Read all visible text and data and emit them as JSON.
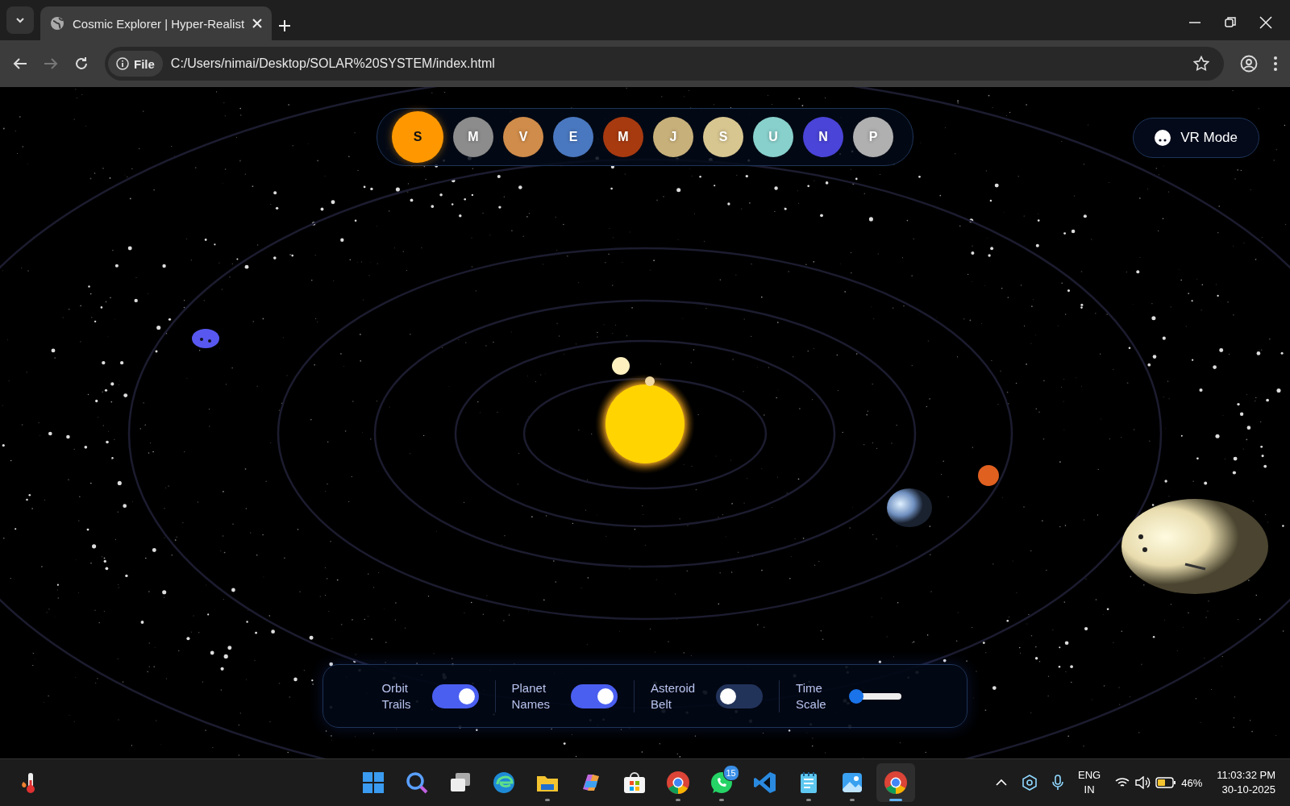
{
  "browser": {
    "tab": {
      "title": "Cosmic Explorer | Hyper-Realist",
      "selected": true
    },
    "address": {
      "scheme_chip": "File",
      "url": "C:/Users/nimai/Desktop/SOLAR%20SYSTEM/index.html"
    }
  },
  "planet_nav": [
    {
      "letter": "S",
      "color": "#ff9800",
      "selected": true
    },
    {
      "letter": "M",
      "color": "#8c8c8c",
      "selected": false
    },
    {
      "letter": "V",
      "color": "#d08c4a",
      "selected": false
    },
    {
      "letter": "E",
      "color": "#4a78c0",
      "selected": false
    },
    {
      "letter": "M",
      "color": "#a83a10",
      "selected": false
    },
    {
      "letter": "J",
      "color": "#c8b07a",
      "selected": false
    },
    {
      "letter": "S",
      "color": "#d8c690",
      "selected": false
    },
    {
      "letter": "U",
      "color": "#88d0cc",
      "selected": false
    },
    {
      "letter": "N",
      "color": "#4a44d8",
      "selected": false
    },
    {
      "letter": "P",
      "color": "#b0b0b0",
      "selected": false
    }
  ],
  "vr_button": {
    "label": "VR Mode"
  },
  "controls": [
    {
      "kind": "toggle",
      "label": "Orbit Trails",
      "on": true
    },
    {
      "kind": "toggle",
      "label": "Planet Names",
      "on": true
    },
    {
      "kind": "toggle",
      "label": "Asteroid Belt",
      "on": false
    },
    {
      "kind": "slider",
      "label": "Time Scale",
      "level": 0.05
    }
  ],
  "taskbar": {
    "apps": [
      {
        "kind": "start",
        "running": false,
        "selected": false
      },
      {
        "kind": "search",
        "running": false,
        "selected": false
      },
      {
        "kind": "taskview",
        "running": false,
        "selected": false
      },
      {
        "kind": "edge",
        "running": false,
        "selected": false
      },
      {
        "kind": "explorer",
        "running": true,
        "selected": false
      },
      {
        "kind": "copilot",
        "running": false,
        "selected": false
      },
      {
        "kind": "store",
        "running": false,
        "selected": false
      },
      {
        "kind": "chrome",
        "running": true,
        "selected": false
      },
      {
        "kind": "whatsapp",
        "running": true,
        "selected": false,
        "badge": "15"
      },
      {
        "kind": "vscode",
        "running": false,
        "selected": false
      },
      {
        "kind": "notepad",
        "running": true,
        "selected": false
      },
      {
        "kind": "photos",
        "running": true,
        "selected": false
      },
      {
        "kind": "chrome",
        "running": true,
        "selected": true
      }
    ],
    "tray": {
      "language": "ENG",
      "region": "IN",
      "battery": "46%",
      "time": "11:03:32 PM",
      "date": "30-10-2025"
    }
  }
}
